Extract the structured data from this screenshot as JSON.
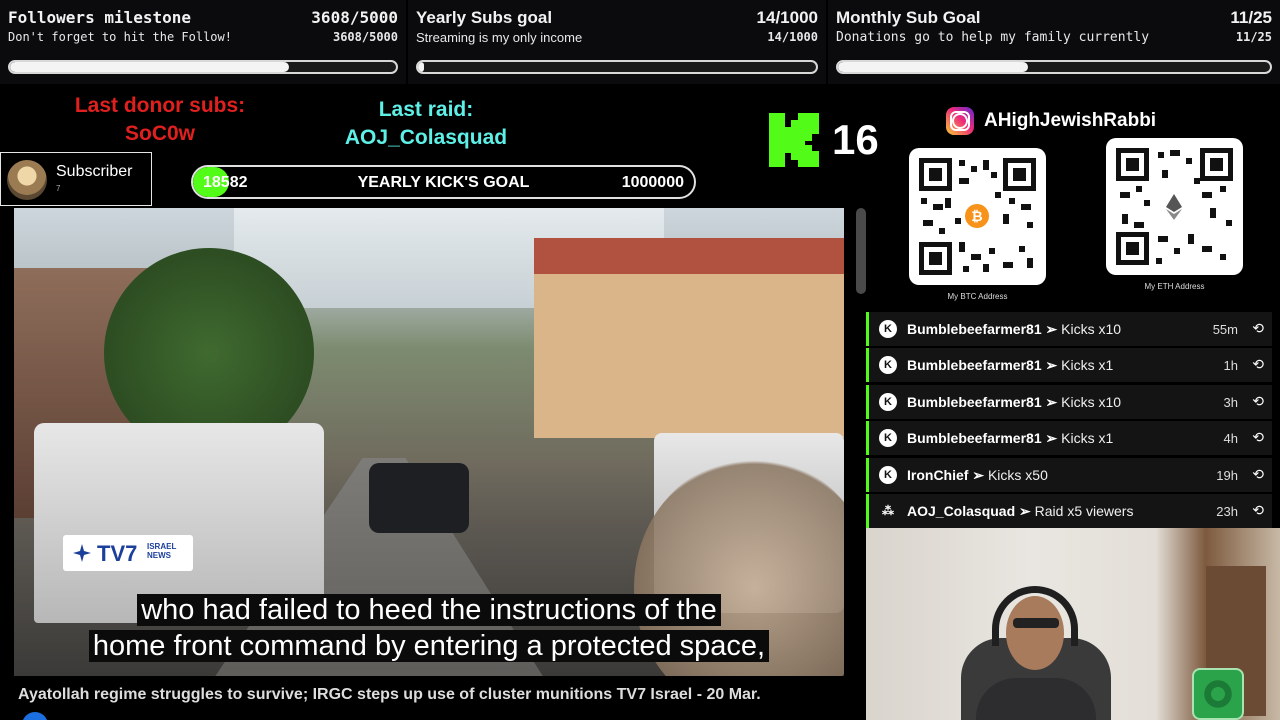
{
  "goals": [
    {
      "title": "Followers milestone",
      "subtitle": "Don't forget to hit the Follow!",
      "count_label": "3608/5000",
      "count_small": "3608/5000",
      "progress": 0.7216
    },
    {
      "title": "Yearly Subs goal",
      "subtitle": "Streaming is my only income",
      "count_label": "14/1000",
      "count_small": "14/1000",
      "progress": 0.014
    },
    {
      "title": "Monthly Sub Goal",
      "subtitle": "Donations go to help my family currently",
      "count_label": "11/25",
      "count_small": "11/25",
      "progress": 0.44
    }
  ],
  "donor": {
    "label": "Last donor subs:",
    "name": "SoC0w"
  },
  "raid": {
    "label": "Last raid:",
    "name": "AOJ_Colasquad"
  },
  "subscriber": {
    "label": "Subscriber",
    "count": "7"
  },
  "kick_goal": {
    "current": "18582",
    "label": "YEARLY KICK'S GOAL",
    "target": "1000000",
    "progress": 0.018582
  },
  "viewer_count": "16",
  "instagram": {
    "handle": "AHighJewishRabbi"
  },
  "qr": [
    {
      "label": "My BTC Address",
      "icon": "bitcoin-icon"
    },
    {
      "label": "My ETH Address",
      "icon": "ethereum-icon"
    }
  ],
  "events": [
    {
      "user": "Bumblebeefarmer81",
      "action": "Kicks x10",
      "time": "55m",
      "icon": "kick-icon"
    },
    {
      "user": "Bumblebeefarmer81",
      "action": "Kicks x1",
      "time": "1h",
      "icon": "kick-icon"
    },
    {
      "user": "Bumblebeefarmer81",
      "action": "Kicks x10",
      "time": "3h",
      "icon": "kick-icon"
    },
    {
      "user": "Bumblebeefarmer81",
      "action": "Kicks x1",
      "time": "4h",
      "icon": "kick-icon"
    },
    {
      "user": "IronChief",
      "action": "Kicks x50",
      "time": "19h",
      "icon": "kick-icon"
    },
    {
      "user": "AOJ_Colasquad",
      "action": "Raid x5 viewers",
      "time": "23h",
      "icon": "raid-icon"
    }
  ],
  "video": {
    "logo_text": "TV7",
    "logo_sub": "ISRAEL NEWS",
    "caption_line1": "who had failed to heed the instructions of the",
    "caption_line2": "home front command by entering a protected space,",
    "title": "Ayatollah regime struggles to survive; IRGC steps up use of cluster munitions TV7 Israel - 20 Mar."
  },
  "colors": {
    "kick_green": "#53fc18",
    "donor_red": "#e0201f",
    "raid_cyan": "#5ef0e6"
  }
}
